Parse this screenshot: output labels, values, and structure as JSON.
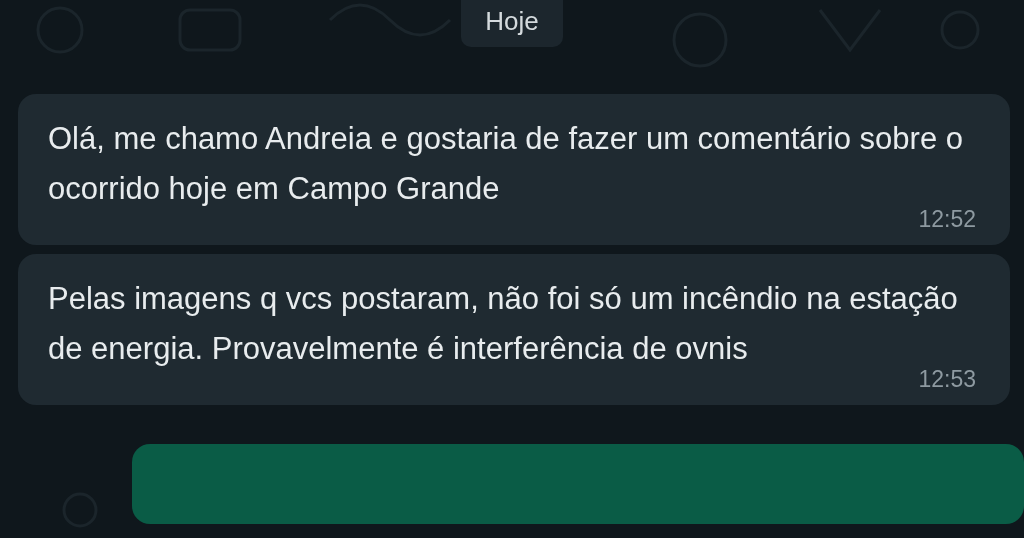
{
  "date_separator": "Hoje",
  "messages": [
    {
      "text": "Olá, me chamo Andreia e gostaria de fazer um comentário sobre o ocorrido hoje em Campo Grande",
      "time": "12:52",
      "kind": "incoming"
    },
    {
      "text": "Pelas imagens q vcs postaram, não foi só um incêndio na estação de energia. Provavelmente é interferência de ovnis",
      "time": "12:53",
      "kind": "incoming"
    },
    {
      "kind": "outgoing"
    }
  ]
}
